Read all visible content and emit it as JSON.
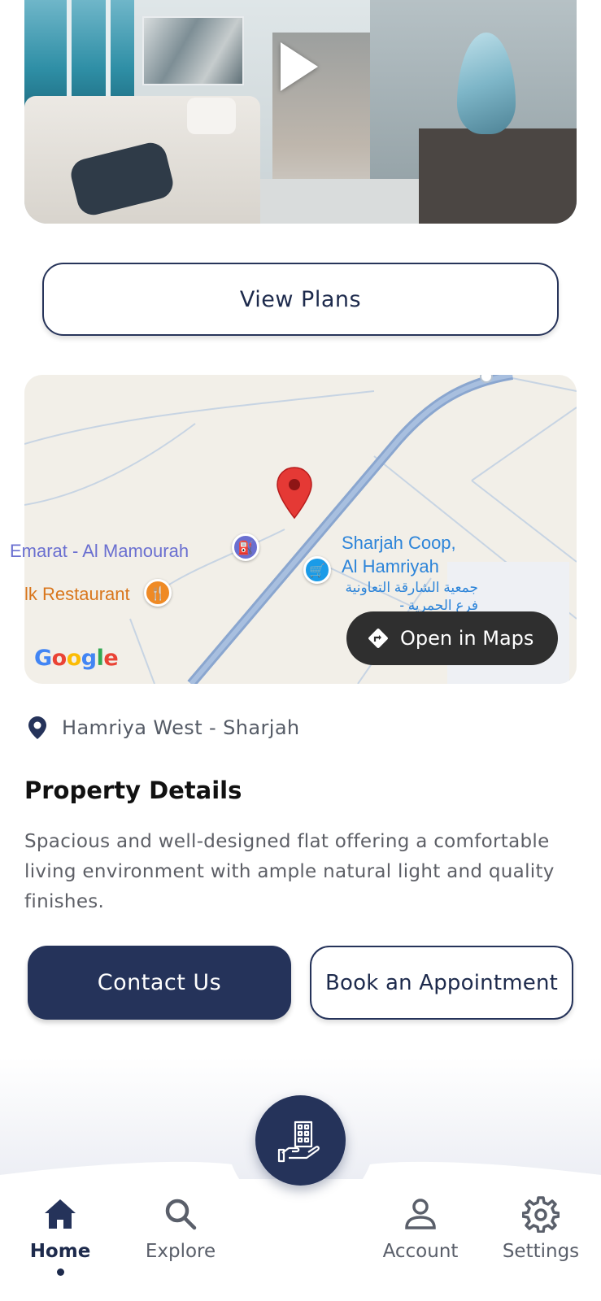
{
  "video": {
    "thumbnail_icon": "play-icon"
  },
  "actions": {
    "view_plans_label": "View Plans",
    "contact_label": "Contact Us",
    "book_label": "Book an Appointment"
  },
  "map": {
    "labels": {
      "emarat": "Emarat - Al Mamourah",
      "restaurant": "lk Restaurant",
      "coop_line1": "Sharjah Coop,",
      "coop_line2": "Al Hamriyah",
      "coop_arabic_line1": "جمعية الشارقة التعاونية",
      "coop_arabic_line2": "فرع الحمرية -"
    },
    "google_logo": "Google",
    "open_maps_label": "Open in Maps",
    "marker_color": "#e53935"
  },
  "property": {
    "location": "Hamriya West - Sharjah",
    "details_title": "Property Details",
    "description": "Spacious and well-designed flat offering a comfortable living environment with ample natural light and quality finishes."
  },
  "nav": {
    "items": [
      {
        "label": "Home",
        "icon": "home-icon",
        "active": true
      },
      {
        "label": "Explore",
        "icon": "search-icon",
        "active": false
      },
      {
        "label": "Account",
        "icon": "user-icon",
        "active": false
      },
      {
        "label": "Settings",
        "icon": "gear-icon",
        "active": false
      }
    ],
    "center_icon": "building-hand-icon"
  },
  "colors": {
    "primary": "#25335a",
    "accent_blue": "#2c84d9"
  }
}
